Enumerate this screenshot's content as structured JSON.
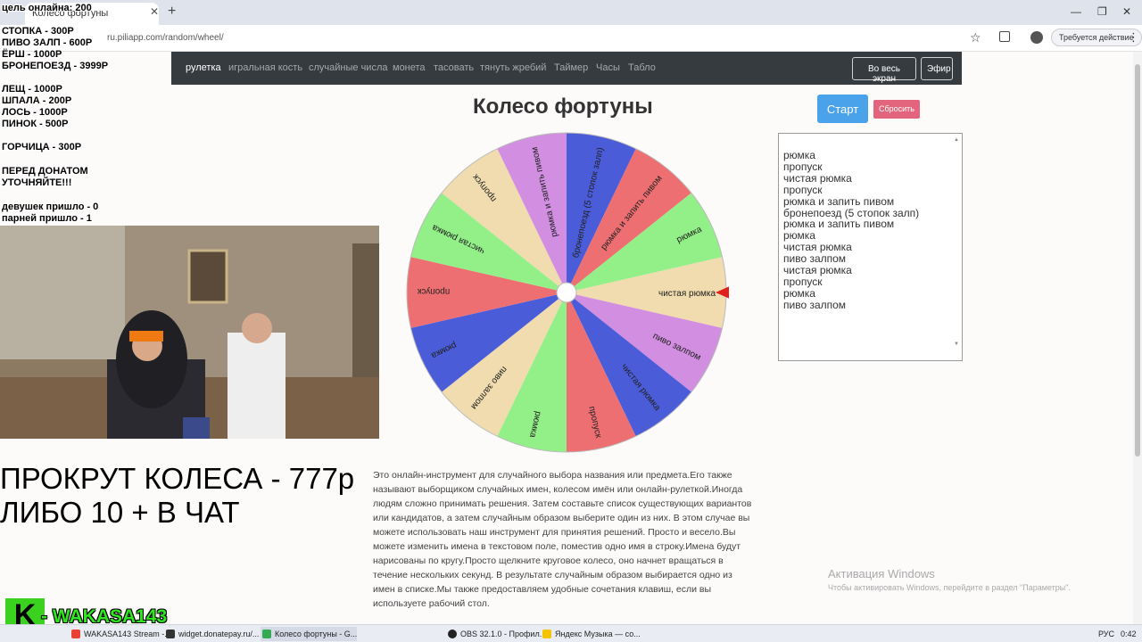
{
  "browser": {
    "tab_title": "Колесо фортуны",
    "url": "ru.piliapp.com/random/wheel/",
    "action_button": "Требуется действие"
  },
  "navbar": {
    "items": [
      "рулетка",
      "игральная кость",
      "случайные числа",
      "монета",
      "тасовать",
      "тянуть жребий",
      "Таймер",
      "Часы",
      "Табло"
    ],
    "fullscreen_label": "Во весь экран",
    "live_label": "Эфир"
  },
  "page": {
    "title": "Колесо фортуны",
    "start_label": "Старт",
    "reset_label": "Сбросить"
  },
  "wheel": {
    "segments": [
      {
        "label": "чистая рюмка",
        "color": "#f0dcae"
      },
      {
        "label": "пиво залпом",
        "color": "#d28ee0"
      },
      {
        "label": "чистая рюмка",
        "color": "#4a5cd8"
      },
      {
        "label": "пропуск",
        "color": "#ee6f72"
      },
      {
        "label": "рюмка",
        "color": "#93ef88"
      },
      {
        "label": "пиво залпом",
        "color": "#f0dcae"
      },
      {
        "label": "рюмка",
        "color": "#4a5cd8"
      },
      {
        "label": "пропуск",
        "color": "#ee6f72"
      },
      {
        "label": "чистая рюмка",
        "color": "#93ef88"
      },
      {
        "label": "пропуск",
        "color": "#f0dcae"
      },
      {
        "label": "рюмка и запить пивом",
        "color": "#d28ee0"
      },
      {
        "label": "бронепоезд (5 стопок залп)",
        "color": "#4a5cd8"
      },
      {
        "label": "рюмка и запить пивом",
        "color": "#ee6f72"
      },
      {
        "label": "рюмка",
        "color": "#93ef88"
      }
    ]
  },
  "list_items": [
    "рюмка",
    "пропуск",
    "чистая рюмка",
    "пропуск",
    "рюмка и запить пивом",
    "бронепоезд (5 стопок залп)",
    "рюмка и запить пивом",
    "рюмка",
    "чистая рюмка",
    "пиво залпом",
    "чистая рюмка",
    "пропуск",
    "рюмка",
    "пиво залпом"
  ],
  "description": "Это онлайн-инструмент для случайного выбора названия или предмета.Его также называют выборщиком случайных имен, колесом имён или онлайн-рулеткой.Иногда людям сложно принимать решения. Затем составьте список существующих вариантов или кандидатов, а затем случайным образом выберите один из них. В этом случае вы можете использовать наш инструмент для принятия решений. Просто и весело.Вы можете изменить имена в текстовом поле, поместив одно имя в строку.Имена будут нарисованы по кругу.Просто щелкните круговое колесо, оно начнет вращаться в течение нескольких секунд. В результате случайным образом выбирается одно из имен в списке.Мы также предоставляем удобные сочетания клавиш, если вы используете рабочий стол.",
  "windows_activation": {
    "title": "Активация Windows",
    "text": "Чтобы активировать Windows, перейдите в раздел \"Параметры\"."
  },
  "overlay": {
    "goal": "цель онлайна: 200",
    "prices": [
      "СТОПКА - 300Р",
      "ПИВО ЗАЛП - 600Р",
      "ЁРШ - 1000Р",
      "БРОНЕПОЕЗД - 3999Р"
    ],
    "prices2": [
      "ЛЕЩ - 1000Р",
      "ШПАЛА - 200Р",
      "ЛОСЬ - 1000Р",
      "ПИНОК - 500Р"
    ],
    "mustard": "ГОРЧИЦА - 300Р",
    "warning": [
      "ПЕРЕД ДОНАТОМ",
      "УТОЧНЯЙТЕ!!!"
    ],
    "counters": [
      "девушек пришло - 0",
      "парней пришло - 1"
    ],
    "promo_line1": "ПРОКРУТ КОЛЕСА - 777р",
    "promo_line2": "ЛИБО 10 + В ЧАТ",
    "logo_letter": "K",
    "logo_name": "- WAKASA143"
  },
  "taskbar": {
    "tasks": [
      "WAKASA143 Stream -...",
      "widget.donatepay.ru/...",
      "Колесо фортуны - G...",
      "OBS 32.1.0 - Профил...",
      "Яндекс Музыка — со..."
    ],
    "lang": "РУС",
    "time": "0:42"
  }
}
